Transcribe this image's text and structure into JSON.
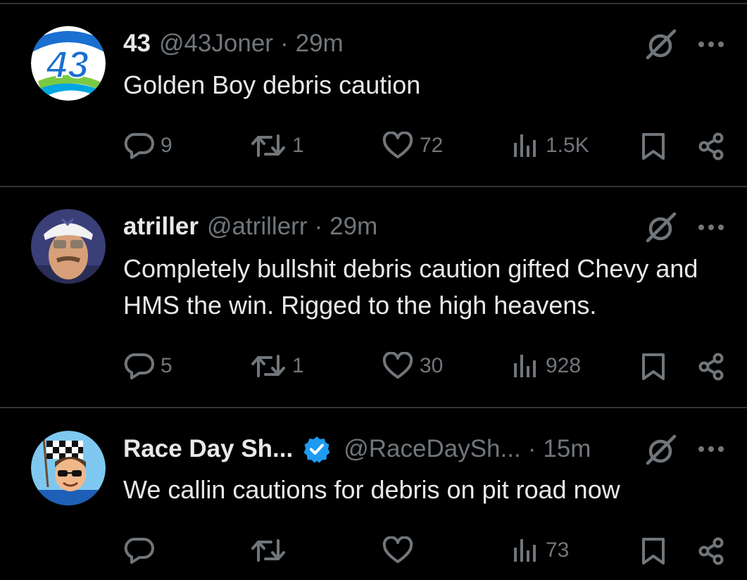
{
  "tweets": [
    {
      "name": "43",
      "handle": "@43Joner",
      "separator": "·",
      "time": "29m",
      "text": "Golden Boy debris caution",
      "replies": "9",
      "reposts": "1",
      "likes": "72",
      "views": "1.5K",
      "verified": false,
      "avatar_text": "43"
    },
    {
      "name": "atriller",
      "handle": "@atrillerr",
      "separator": "·",
      "time": "29m",
      "text": "Completely bullshit debris caution gifted Chevy and HMS the win. Rigged to the high heavens.",
      "replies": "5",
      "reposts": "1",
      "likes": "30",
      "views": "928",
      "verified": false
    },
    {
      "name": "Race Day Sh...",
      "handle": "@RaceDaySh...",
      "separator": "·",
      "time": "15m",
      "text": "We callin cautions for debris on pit road now",
      "replies": "",
      "reposts": "",
      "likes": "",
      "views": "73",
      "verified": true
    }
  ],
  "icons": {
    "reply": "reply-icon",
    "repost": "repost-icon",
    "like": "heart-icon",
    "views": "views-icon",
    "bookmark": "bookmark-icon",
    "share": "share-icon",
    "grok": "grok-icon",
    "more": "more-icon",
    "verified": "verified-badge-icon"
  },
  "colors": {
    "background": "#000000",
    "text": "#e7e9ea",
    "muted": "#71767b",
    "divider": "#2f3336",
    "verified": "#1d9bf0"
  }
}
